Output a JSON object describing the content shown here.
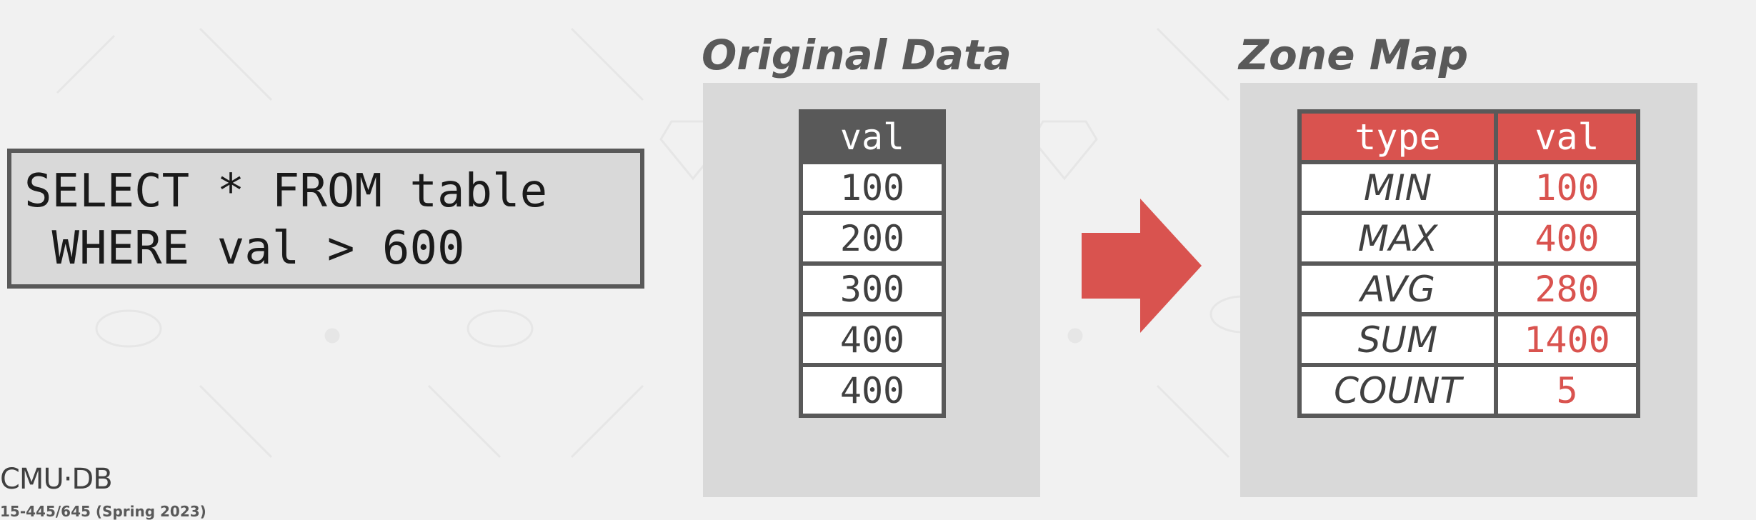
{
  "query": {
    "line1": "SELECT * FROM table",
    "line2": " WHERE val > 600"
  },
  "original_data": {
    "title": "Original Data",
    "header": "val",
    "rows": [
      "100",
      "200",
      "300",
      "400",
      "400"
    ]
  },
  "zone_map": {
    "title": "Zone Map",
    "headers": [
      "type",
      "val"
    ],
    "rows": [
      {
        "type": "MIN",
        "val": "100"
      },
      {
        "type": "MAX",
        "val": "400"
      },
      {
        "type": "AVG",
        "val": "280"
      },
      {
        "type": "SUM",
        "val": "1400"
      },
      {
        "type": "COUNT",
        "val": "5"
      }
    ]
  },
  "footer": {
    "logo": "CMU·DB",
    "course": "15-445/645 (Spring 2023)"
  },
  "colors": {
    "accent": "#d9534f",
    "dark": "#595959",
    "panel": "#d9d9d9",
    "background": "#f1f1f1"
  },
  "icons": {
    "arrow": "right-arrow-icon"
  }
}
